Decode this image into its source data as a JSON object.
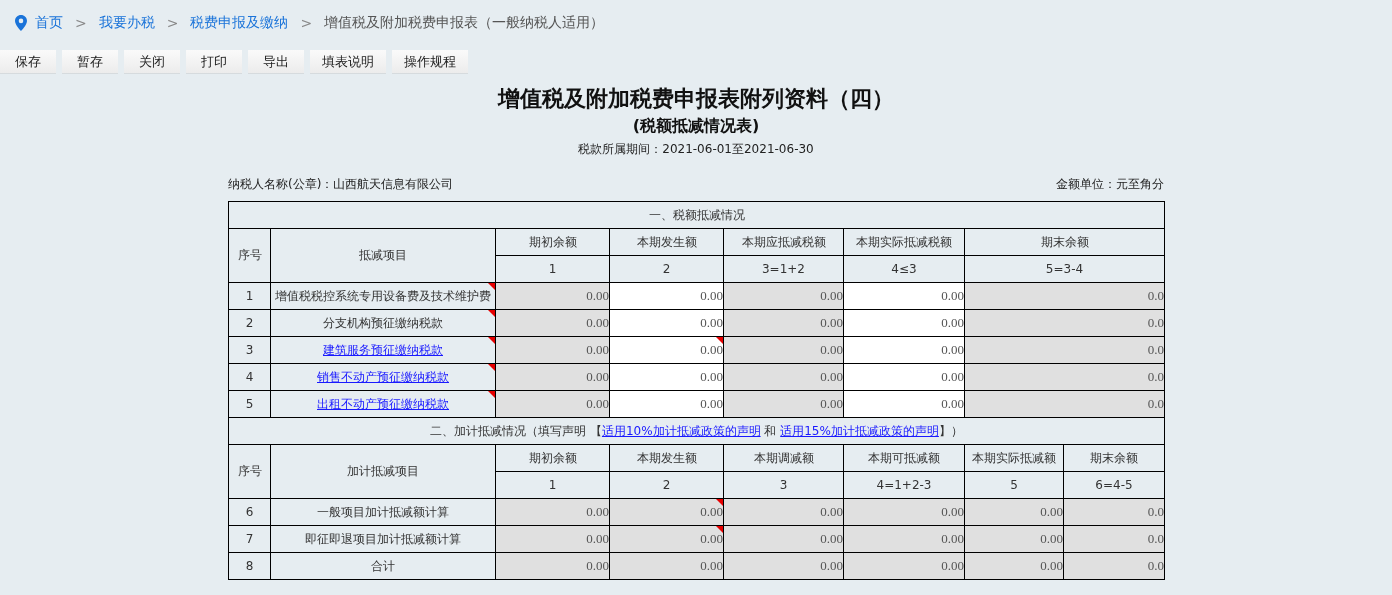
{
  "breadcrumb": [
    {
      "label": "首页",
      "kind": "link"
    },
    {
      "label": "我要办税",
      "kind": "link"
    },
    {
      "label": "税费申报及缴纳",
      "kind": "link"
    },
    {
      "label": "增值税及附加税费申报表（一般纳税人适用）",
      "kind": "current"
    }
  ],
  "breadcrumb_separator": ">",
  "toolbar": [
    "保存",
    "暂存",
    "关闭",
    "打印",
    "导出",
    "填表说明",
    "操作规程"
  ],
  "title": "增值税及附加税费申报表附列资料（四）",
  "subtitle": "(税额抵减情况表)",
  "period": "税款所属期间：2021-06-01至2021-06-30",
  "taxpayer": "纳税人名称(公章)：山西航天信息有限公司",
  "unit": "金额单位：元至角分",
  "sections": [
    {
      "title_parts": [
        {
          "kind": "text",
          "text": "一、税额抵减情况"
        }
      ],
      "seq_header": "序号",
      "item_header": "抵减项目",
      "columns": [
        {
          "label": "期初余额",
          "formula": "1"
        },
        {
          "label": "本期发生额",
          "formula": "2"
        },
        {
          "label": "本期应抵减税额",
          "formula": "3=1+2"
        },
        {
          "label": "本期实际抵减税额",
          "formula": "4≤3"
        },
        {
          "label": "期末余额",
          "formula": "5=3-4"
        }
      ],
      "rows": [
        {
          "seq": "1",
          "item": "增值税税控系统专用设备费及技术维护费",
          "item_link": false,
          "item_flagged": true,
          "cells": [
            {
              "value": "0.00",
              "editable": false,
              "flagged": false
            },
            {
              "value": "0.00",
              "editable": true,
              "flagged": false
            },
            {
              "value": "0.00",
              "editable": false,
              "flagged": false
            },
            {
              "value": "0.00",
              "editable": true,
              "flagged": false
            },
            {
              "value": "0.0",
              "editable": false,
              "flagged": false
            }
          ]
        },
        {
          "seq": "2",
          "item": "分支机构预征缴纳税款",
          "item_link": false,
          "item_flagged": true,
          "cells": [
            {
              "value": "0.00",
              "editable": false,
              "flagged": false
            },
            {
              "value": "0.00",
              "editable": true,
              "flagged": false
            },
            {
              "value": "0.00",
              "editable": false,
              "flagged": false
            },
            {
              "value": "0.00",
              "editable": true,
              "flagged": false
            },
            {
              "value": "0.0",
              "editable": false,
              "flagged": false
            }
          ]
        },
        {
          "seq": "3",
          "item": "建筑服务预征缴纳税款",
          "item_link": true,
          "item_flagged": true,
          "cells": [
            {
              "value": "0.00",
              "editable": false,
              "flagged": false
            },
            {
              "value": "0.00",
              "editable": true,
              "flagged": true
            },
            {
              "value": "0.00",
              "editable": false,
              "flagged": false
            },
            {
              "value": "0.00",
              "editable": true,
              "flagged": false
            },
            {
              "value": "0.0",
              "editable": false,
              "flagged": false
            }
          ]
        },
        {
          "seq": "4",
          "item": "销售不动产预征缴纳税款",
          "item_link": true,
          "item_flagged": true,
          "cells": [
            {
              "value": "0.00",
              "editable": false,
              "flagged": false
            },
            {
              "value": "0.00",
              "editable": true,
              "flagged": false
            },
            {
              "value": "0.00",
              "editable": false,
              "flagged": false
            },
            {
              "value": "0.00",
              "editable": true,
              "flagged": false
            },
            {
              "value": "0.0",
              "editable": false,
              "flagged": false
            }
          ]
        },
        {
          "seq": "5",
          "item": "出租不动产预征缴纳税款",
          "item_link": true,
          "item_flagged": true,
          "cells": [
            {
              "value": "0.00",
              "editable": false,
              "flagged": false
            },
            {
              "value": "0.00",
              "editable": true,
              "flagged": false
            },
            {
              "value": "0.00",
              "editable": false,
              "flagged": false
            },
            {
              "value": "0.00",
              "editable": true,
              "flagged": false
            },
            {
              "value": "0.0",
              "editable": false,
              "flagged": false
            }
          ]
        }
      ]
    },
    {
      "title_parts": [
        {
          "kind": "text",
          "text": "二、加计抵减情况（填写声明 【"
        },
        {
          "kind": "link",
          "text": "适用10%加计抵减政策的声明"
        },
        {
          "kind": "text",
          "text": " 和 "
        },
        {
          "kind": "link",
          "text": "适用15%加计抵减政策的声明"
        },
        {
          "kind": "text",
          "text": "】）"
        }
      ],
      "seq_header": "序号",
      "item_header": "加计抵减项目",
      "columns": [
        {
          "label": "期初余额",
          "formula": "1"
        },
        {
          "label": "本期发生额",
          "formula": "2"
        },
        {
          "label": "本期调减额",
          "formula": "3"
        },
        {
          "label": "本期可抵减额",
          "formula": "4=1+2-3"
        },
        {
          "label": "本期实际抵减额",
          "formula": "5"
        },
        {
          "label": "期末余额",
          "formula": "6=4-5"
        }
      ],
      "rows": [
        {
          "seq": "6",
          "item": "一般项目加计抵减额计算",
          "item_link": false,
          "item_flagged": false,
          "cells": [
            {
              "value": "0.00",
              "editable": false,
              "flagged": false
            },
            {
              "value": "0.00",
              "editable": false,
              "flagged": true
            },
            {
              "value": "0.00",
              "editable": false,
              "flagged": false
            },
            {
              "value": "0.00",
              "editable": false,
              "flagged": false
            },
            {
              "value": "0.00",
              "editable": false,
              "flagged": false
            },
            {
              "value": "0.0",
              "editable": false,
              "flagged": false
            }
          ]
        },
        {
          "seq": "7",
          "item": "即征即退项目加计抵减额计算",
          "item_link": false,
          "item_flagged": false,
          "cells": [
            {
              "value": "0.00",
              "editable": false,
              "flagged": false
            },
            {
              "value": "0.00",
              "editable": false,
              "flagged": true
            },
            {
              "value": "0.00",
              "editable": false,
              "flagged": false
            },
            {
              "value": "0.00",
              "editable": false,
              "flagged": false
            },
            {
              "value": "0.00",
              "editable": false,
              "flagged": false
            },
            {
              "value": "0.0",
              "editable": false,
              "flagged": false
            }
          ]
        },
        {
          "seq": "8",
          "item": "合计",
          "item_link": false,
          "item_flagged": false,
          "cells": [
            {
              "value": "0.00",
              "editable": false,
              "flagged": false
            },
            {
              "value": "0.00",
              "editable": false,
              "flagged": false
            },
            {
              "value": "0.00",
              "editable": false,
              "flagged": false
            },
            {
              "value": "0.00",
              "editable": false,
              "flagged": false
            },
            {
              "value": "0.00",
              "editable": false,
              "flagged": false
            },
            {
              "value": "0.0",
              "editable": false,
              "flagged": false
            }
          ]
        }
      ]
    }
  ]
}
